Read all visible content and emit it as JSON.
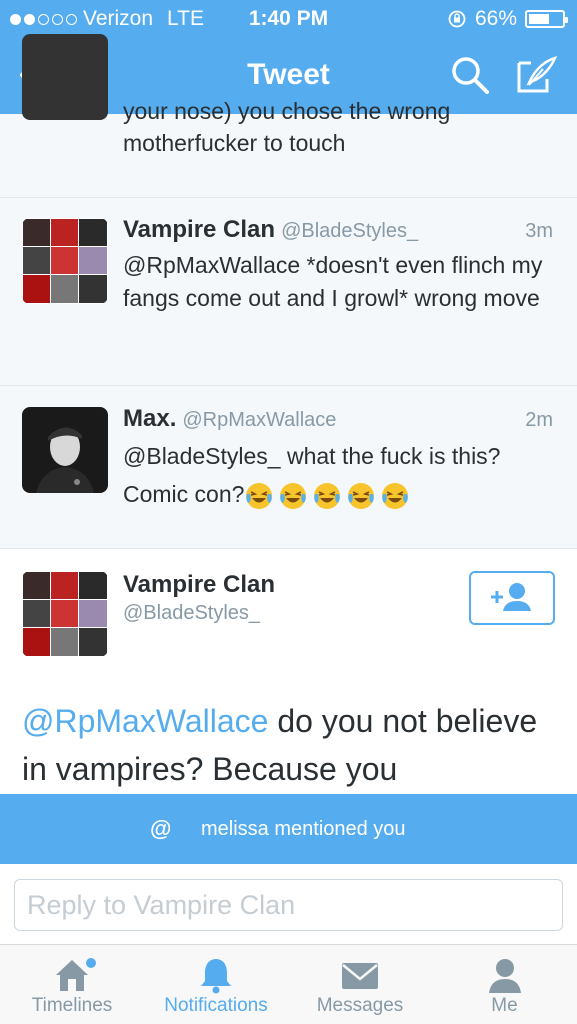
{
  "status": {
    "carrier": "Verizon",
    "network": "LTE",
    "time": "1:40 PM",
    "battery": "66%",
    "battery_level": 0.66,
    "signal_bars": 2
  },
  "nav": {
    "title": "Tweet",
    "back_icon": "chevron-left-icon",
    "search_icon": "search-icon",
    "compose_icon": "compose-icon"
  },
  "feed": {
    "cut_top_text": "your nose) you chose the wrong",
    "cut_bottom_text": "motherfucker to touch",
    "tweets": [
      {
        "name": "Vampire Clan",
        "handle": "@BladeStyles_",
        "time": "3m",
        "body": "@RpMaxWallace *doesn't even flinch my fangs come out and I growl* wrong move"
      },
      {
        "name": "Max.",
        "handle": "@RpMaxWallace",
        "time": "2m",
        "body": "@BladeStyles_ what the fuck is this? Comic con?",
        "emoji_count": 5
      }
    ]
  },
  "detail": {
    "name": "Vampire Clan",
    "handle": "@BladeStyles_",
    "mention": "@RpMaxWallace",
    "body": " do you not believe in vampires? Because you",
    "follow_icon": "add-user-icon"
  },
  "toast": {
    "icon": "@",
    "text": "melissa mentioned you"
  },
  "reply": {
    "placeholder": "Reply to Vampire Clan"
  },
  "tabs": [
    {
      "label": "Timelines",
      "icon": "home-icon",
      "active": false
    },
    {
      "label": "Notifications",
      "icon": "bell-icon",
      "active": true
    },
    {
      "label": "Messages",
      "icon": "envelope-icon",
      "active": false
    },
    {
      "label": "Me",
      "icon": "person-icon",
      "active": false
    }
  ],
  "colors": {
    "brand": "#55acee",
    "text": "#292f33",
    "muted": "#8899a6"
  }
}
